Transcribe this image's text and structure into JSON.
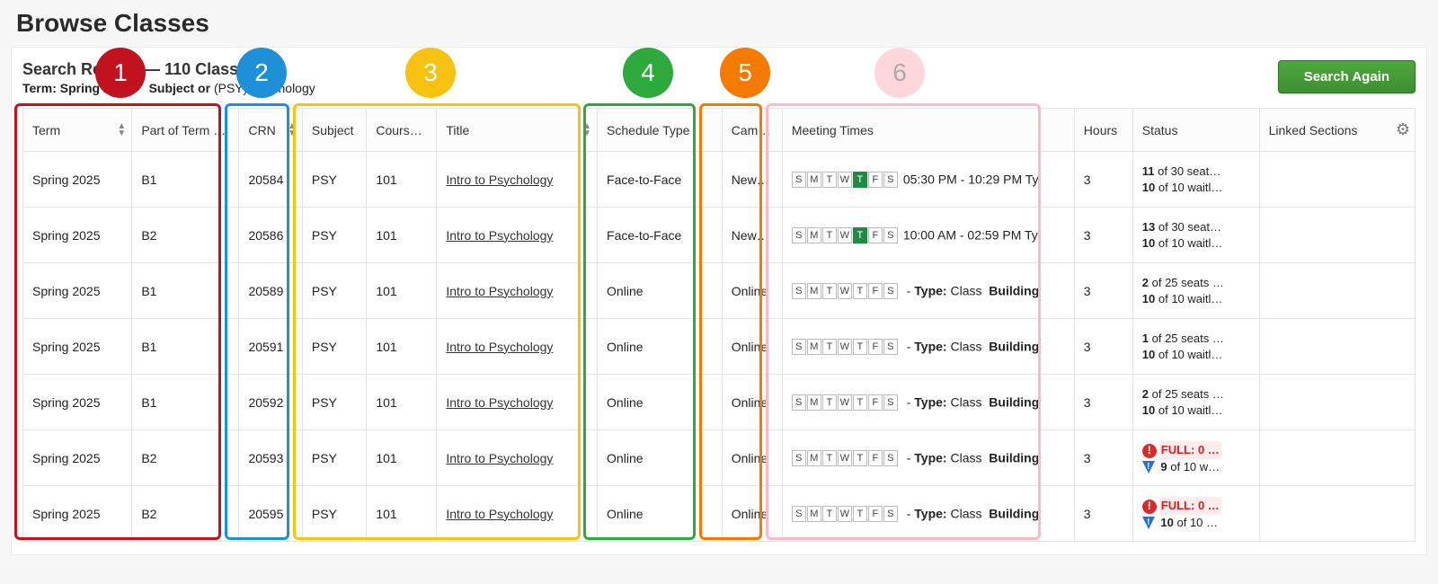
{
  "page_title": "Browse Classes",
  "results_heading_prefix": "Search Results — ",
  "results_count_text": "110 Classes",
  "term_label": "Term: ",
  "term_value": "Spring 2025",
  "subject_label": "Subject or ",
  "subject_value": "(PSY) Psychology",
  "search_again": "Search Again",
  "columns": {
    "term": "Term",
    "pot": "Part of Term (…",
    "crn": "CRN",
    "subject": "Subject",
    "course_num": "Course N",
    "title": "Title",
    "schedule_type": "Schedule Type",
    "campus": "Campus",
    "meeting_times": "Meeting Times",
    "hours": "Hours",
    "status": "Status",
    "linked": "Linked Sections"
  },
  "days": [
    "S",
    "M",
    "T",
    "W",
    "T",
    "F",
    "S"
  ],
  "type_label": "Type:",
  "class_word": "Class",
  "building_word": "Building",
  "full_word": "FULL",
  "rows": [
    {
      "term": "Spring 2025",
      "pot": "B1",
      "crn": "20584",
      "subject": "PSY",
      "course_num": "101",
      "title": "Intro to Psychology",
      "schedule_type": "Face-to-Face",
      "campus": "New…",
      "active_days": [
        4
      ],
      "time_text": "05:30 PM - 10:29 PM Ty",
      "has_time": true,
      "hours": "3",
      "status_line1_bold": "11",
      "status_line1_rest": " of 30 seat…",
      "status_line2_bold": "10",
      "status_line2_rest": " of 10 waitl…",
      "full": false
    },
    {
      "term": "Spring 2025",
      "pot": "B2",
      "crn": "20586",
      "subject": "PSY",
      "course_num": "101",
      "title": "Intro to Psychology",
      "schedule_type": "Face-to-Face",
      "campus": "New…",
      "active_days": [
        4
      ],
      "time_text": "10:00 AM - 02:59 PM Ty",
      "has_time": true,
      "hours": "3",
      "status_line1_bold": "13",
      "status_line1_rest": " of 30 seat…",
      "status_line2_bold": "10",
      "status_line2_rest": " of 10 waitl…",
      "full": false
    },
    {
      "term": "Spring 2025",
      "pot": "B1",
      "crn": "20589",
      "subject": "PSY",
      "course_num": "101",
      "title": "Intro to Psychology",
      "schedule_type": "Online",
      "campus": "Online",
      "active_days": [],
      "time_text": "",
      "has_time": false,
      "hours": "3",
      "status_line1_bold": "2",
      "status_line1_rest": " of 25 seats …",
      "status_line2_bold": "10",
      "status_line2_rest": " of 10 waitl…",
      "full": false
    },
    {
      "term": "Spring 2025",
      "pot": "B1",
      "crn": "20591",
      "subject": "PSY",
      "course_num": "101",
      "title": "Intro to Psychology",
      "schedule_type": "Online",
      "campus": "Online",
      "active_days": [],
      "time_text": "",
      "has_time": false,
      "hours": "3",
      "status_line1_bold": "1",
      "status_line1_rest": " of 25 seats …",
      "status_line2_bold": "10",
      "status_line2_rest": " of 10 waitl…",
      "full": false
    },
    {
      "term": "Spring 2025",
      "pot": "B1",
      "crn": "20592",
      "subject": "PSY",
      "course_num": "101",
      "title": "Intro to Psychology",
      "schedule_type": "Online",
      "campus": "Online",
      "active_days": [],
      "time_text": "",
      "has_time": false,
      "hours": "3",
      "status_line1_bold": "2",
      "status_line1_rest": " of 25 seats …",
      "status_line2_bold": "10",
      "status_line2_rest": " of 10 waitl…",
      "full": false
    },
    {
      "term": "Spring 2025",
      "pot": "B2",
      "crn": "20593",
      "subject": "PSY",
      "course_num": "101",
      "title": "Intro to Psychology",
      "schedule_type": "Online",
      "campus": "Online",
      "active_days": [],
      "time_text": "",
      "has_time": false,
      "hours": "3",
      "status_line1_bold": "",
      "status_line1_rest": ": 0 …",
      "status_line2_bold": "9",
      "status_line2_rest": " of 10 w…",
      "full": true
    },
    {
      "term": "Spring 2025",
      "pot": "B2",
      "crn": "20595",
      "subject": "PSY",
      "course_num": "101",
      "title": "Intro to Psychology",
      "schedule_type": "Online",
      "campus": "Online",
      "active_days": [],
      "time_text": "",
      "has_time": false,
      "hours": "3",
      "status_line1_bold": "",
      "status_line1_rest": ": 0 …",
      "status_line2_bold": "10",
      "status_line2_rest": " of 10 …",
      "full": true
    }
  ],
  "annotations": [
    "1",
    "2",
    "3",
    "4",
    "5",
    "6"
  ]
}
